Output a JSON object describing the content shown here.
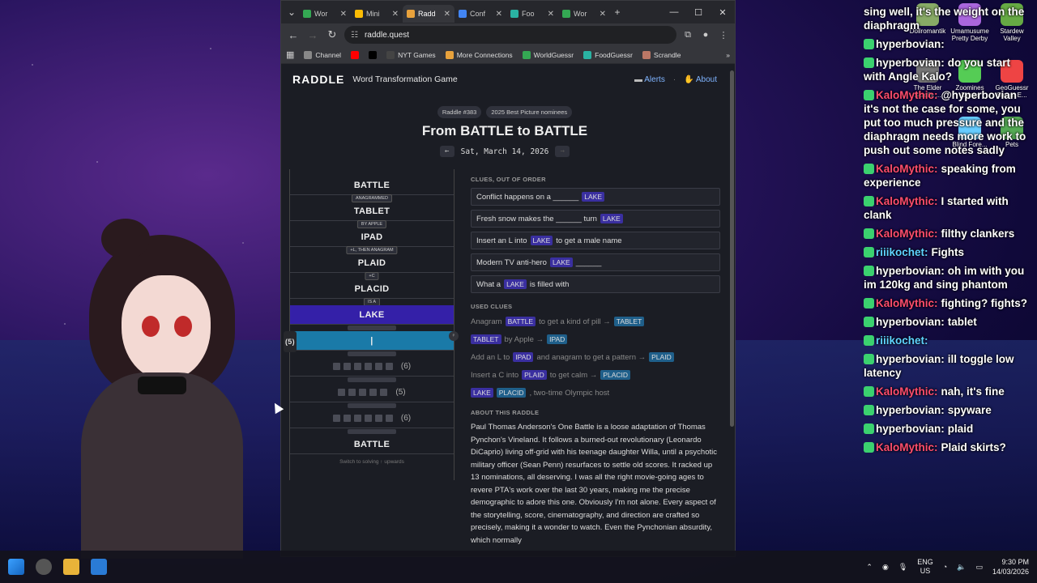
{
  "browser": {
    "tabs": [
      {
        "label": "Wor",
        "color": "#34a853"
      },
      {
        "label": "Mini",
        "color": "#fbbc04"
      },
      {
        "label": "Radd",
        "color": "#e8a23c",
        "active": true
      },
      {
        "label": "Conf",
        "color": "#4285f4"
      },
      {
        "label": "Foo",
        "color": "#2ab3a3"
      },
      {
        "label": "Wor",
        "color": "#34a853"
      }
    ],
    "url": "raddle.quest",
    "bookmarks": [
      {
        "label": "Channel",
        "color": "#888"
      },
      {
        "label": "",
        "color": "#ff0000"
      },
      {
        "label": "",
        "color": "#000"
      },
      {
        "label": "NYT Games",
        "color": "#444"
      },
      {
        "label": "More Connections",
        "color": "#e8a23c"
      },
      {
        "label": "WorldGuessr",
        "color": "#34a853"
      },
      {
        "label": "FoodGuessr",
        "color": "#2ab3a3"
      },
      {
        "label": "Scrandle",
        "color": "#b76"
      }
    ]
  },
  "raddle": {
    "logo": "RADDLE",
    "tagline": "Word Transformation Game",
    "alerts": "Alerts",
    "about": "About",
    "puzzle_no": "Raddle #383",
    "theme": "2025 Best Picture nominees",
    "title": "From BATTLE to BATTLE",
    "date": "Sat, March 14, 2026",
    "ladder": [
      {
        "word": "BATTLE",
        "conn": "ANAGRAMMED"
      },
      {
        "word": "TABLET",
        "conn": "BY APPLE"
      },
      {
        "word": "IPAD",
        "conn": "+L, THEN ANAGRAM"
      },
      {
        "word": "PLAID",
        "conn": "+C"
      },
      {
        "word": "PLACID",
        "conn": "IS A"
      },
      {
        "word": "LAKE",
        "conn": ""
      }
    ],
    "active_count": "(5)",
    "active_value": "|",
    "blanks": [
      "(6)",
      "(5)",
      "(6)"
    ],
    "blank_box_counts": [
      6,
      5,
      6
    ],
    "end_word": "BATTLE",
    "switch_hint": "Switch to solving ↑ upwards",
    "clues_heading": "CLUES, OUT OF ORDER",
    "clues": [
      {
        "pre": "Conflict happens on a ______",
        "tag": "LAKE",
        "post": ""
      },
      {
        "pre": "Fresh snow makes the ______ turn",
        "tag": "LAKE",
        "post": ""
      },
      {
        "pre": "Insert an L into",
        "tag": "LAKE",
        "post": "to get a male name"
      },
      {
        "pre": "Modern TV anti-hero",
        "tag": "LAKE",
        "post": "______"
      },
      {
        "pre": "What a",
        "tag": "LAKE",
        "post": "is filled with"
      }
    ],
    "used_heading": "USED CLUES",
    "used": [
      {
        "a": "Anagram",
        "w1": "BATTLE",
        "b": "to get a kind of pill →",
        "w2": "TABLET"
      },
      {
        "a": "",
        "w1": "TABLET",
        "b": "by Apple →",
        "w2": "IPAD"
      },
      {
        "a": "Add an L to",
        "w1": "IPAD",
        "b": "and anagram to get a pattern →",
        "w2": "PLAID"
      },
      {
        "a": "Insert a C into",
        "w1": "PLAID",
        "b": "to get calm →",
        "w2": "PLACID"
      },
      {
        "a": "",
        "w1": "LAKE",
        "b": "",
        "w2": "PLACID",
        "c": ", two-time Olympic host"
      }
    ],
    "about_heading": "ABOUT THIS RADDLE",
    "about_text": "Paul Thomas Anderson's One Battle is a loose adaptation of Thomas Pynchon's Vineland. It follows a burned-out revolutionary (Leonardo DiCaprio) living off-grid with his teenage daughter Willa, until a psychotic military officer (Sean Penn) resurfaces to settle old scores. It racked up 13 nominations, all deserving. I was all the right movie-going ages to revere PTA's work over the last 30 years, making me the precise demographic to adore this one. Obviously I'm not alone. Every aspect of the storytelling, score, cinematography, and direction are crafted so precisely, making it a wonder to watch. Even the Pynchonian absurdity, which normally"
  },
  "chat": [
    {
      "name": "",
      "text": "sing well, it's the weight on the diaphragm",
      "color": "#fff"
    },
    {
      "name": "hyperbovian:",
      "text": "",
      "color": "#fff"
    },
    {
      "name": "hyperbovian:",
      "text": "do you start with Angle Kalo?",
      "color": "#fff"
    },
    {
      "name": "KaloMythic:",
      "text": "@hyperbovian it's not the case for some, you put too much pressure and the diaphragm needs more work to push out some notes sadly",
      "color": "#ff4d6d"
    },
    {
      "name": "KaloMythic:",
      "text": "speaking from experience",
      "color": "#ff4d6d"
    },
    {
      "name": "KaloMythic:",
      "text": "I started with clank",
      "color": "#ff4d6d"
    },
    {
      "name": "KaloMythic:",
      "text": "filthy clankers",
      "color": "#ff4d6d"
    },
    {
      "name": "riiikochet:",
      "text": "Fights",
      "color": "#5fd3ff"
    },
    {
      "name": "hyperbovian:",
      "text": "oh im with you im 120kg and sing phantom",
      "color": "#fff"
    },
    {
      "name": "KaloMythic:",
      "text": "fighting? fights?",
      "color": "#ff4d6d"
    },
    {
      "name": "hyperbovian:",
      "text": "tablet",
      "color": "#fff"
    },
    {
      "name": "riiikochet:",
      "text": "",
      "color": "#5fd3ff"
    },
    {
      "name": "hyperbovian:",
      "text": "ill toggle low latency",
      "color": "#fff"
    },
    {
      "name": "KaloMythic:",
      "text": "nah, it's fine",
      "color": "#ff4d6d"
    },
    {
      "name": "hyperbovian:",
      "text": "spyware",
      "color": "#fff"
    },
    {
      "name": "hyperbovian:",
      "text": "plaid",
      "color": "#fff"
    },
    {
      "name": "KaloMythic:",
      "text": "Plaid skirts?",
      "color": "#ff4d6d"
    }
  ],
  "desktop_icons": [
    {
      "label": "Dollromantik",
      "color": "#8a6"
    },
    {
      "label": "Umamusume Pretty Derby",
      "color": "#a6d"
    },
    {
      "label": "Stardew Valley",
      "color": "#6a4"
    },
    {
      "label": "The Elder Scrolls ...",
      "color": "#777"
    },
    {
      "label": "Zoomines Demo",
      "color": "#5c5"
    },
    {
      "label": "GeoGuessr Steam E...",
      "color": "#e44"
    },
    {
      "label": "Blind Fore...",
      "color": "#6cf"
    },
    {
      "label": "Pets",
      "color": "#5a5"
    }
  ],
  "taskbar": {
    "lang": "ENG",
    "region": "US",
    "time": "9:30 PM",
    "date": "14/03/2026"
  }
}
